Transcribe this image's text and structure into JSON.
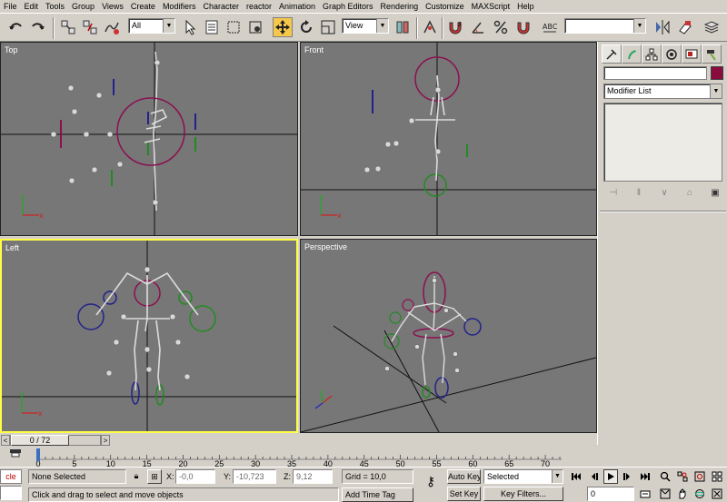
{
  "menu": [
    "File",
    "Edit",
    "Tools",
    "Group",
    "Views",
    "Create",
    "Modifiers",
    "Character",
    "reactor",
    "Animation",
    "Graph Editors",
    "Rendering",
    "Customize",
    "MAXScript",
    "Help"
  ],
  "toolbar": {
    "selection_filter": "All",
    "reference_coord": "View",
    "named_selection": ""
  },
  "viewports": {
    "top": "Top",
    "front": "Front",
    "left": "Left",
    "perspective": "Perspective"
  },
  "axes": {
    "x": "x",
    "y": "y"
  },
  "command_panel": {
    "object_name": "",
    "object_color": "#8a0c3e",
    "modifier_list": "Modifier List"
  },
  "time_slider": {
    "frame_display": "0 / 72",
    "current_frame": 0,
    "total_frames": 72
  },
  "trackbar": {
    "labels": [
      "0",
      "5",
      "10",
      "15",
      "20",
      "25",
      "30",
      "35",
      "40",
      "45",
      "50",
      "55",
      "60",
      "65",
      "70"
    ]
  },
  "status": {
    "listener_label": "cle",
    "selection": "None Selected",
    "x_label": "X:",
    "x_value": "-0,0",
    "y_label": "Y:",
    "y_value": "-10,723",
    "z_label": "Z:",
    "z_value": "9,12",
    "grid": "Grid = 10,0",
    "prompt": "Click and drag to select and move objects",
    "add_time_tag": "Add Time Tag",
    "auto_key": "Auto Key",
    "set_key": "Set Key",
    "key_mode": "Selected",
    "key_filters": "Key Filters...",
    "frame_field": "0"
  }
}
